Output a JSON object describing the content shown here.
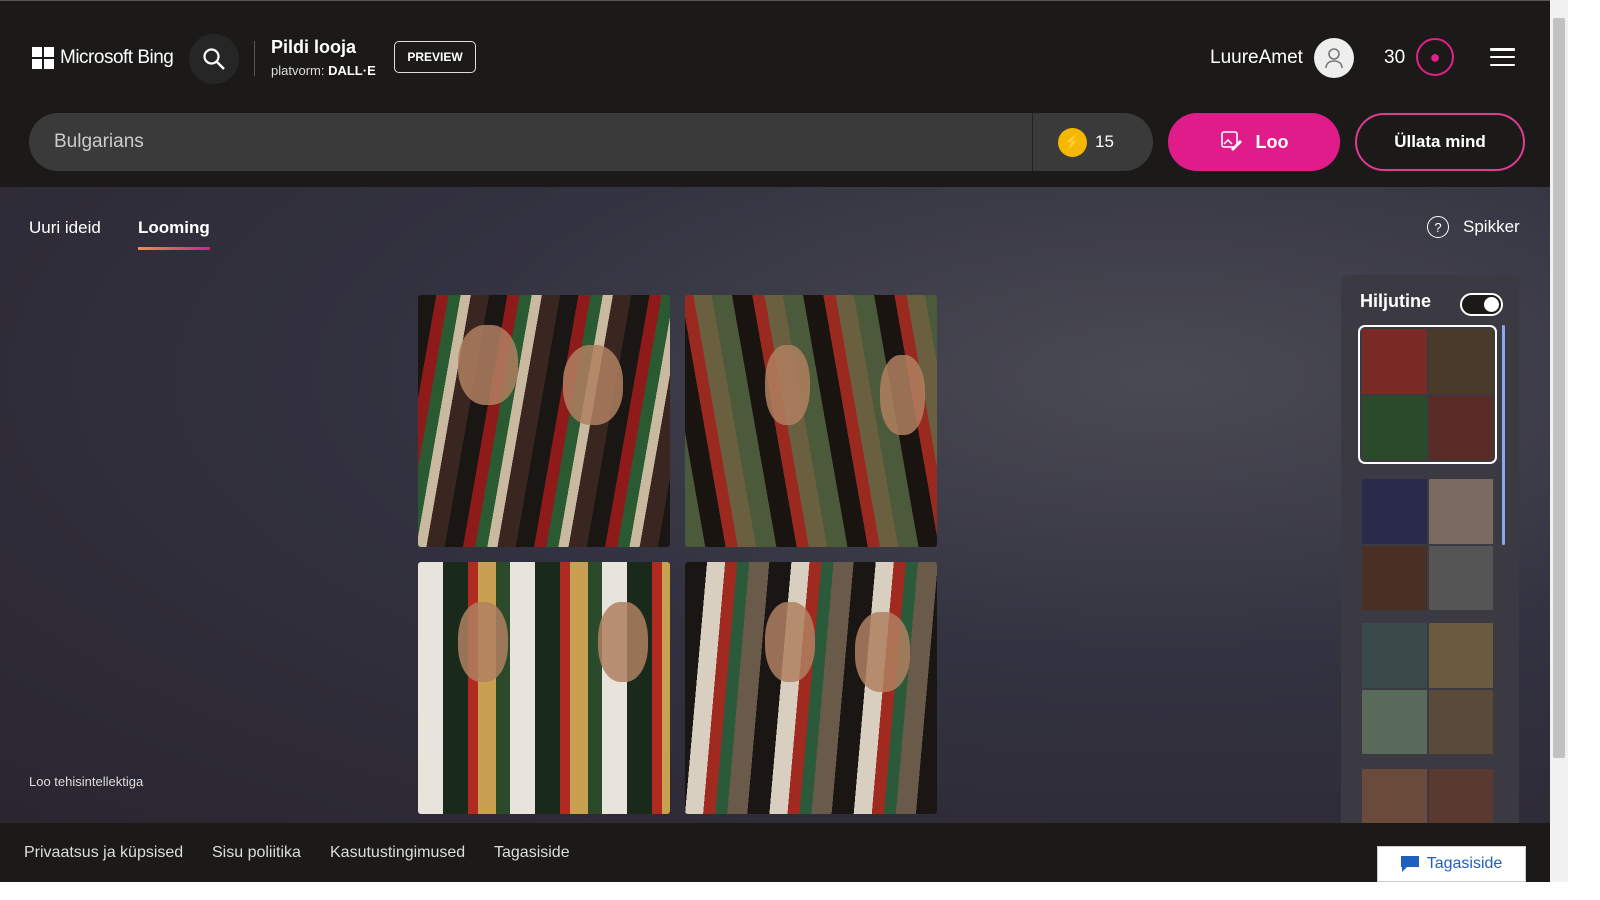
{
  "header": {
    "brand": "Microsoft Bing",
    "title": "Pildi looja",
    "platform_label": "platvorm:",
    "platform_value": "DALL·E",
    "preview": "PREVIEW",
    "username": "LuureAmet",
    "points": "30"
  },
  "search": {
    "value": "Bulgarians",
    "boosts": "15",
    "create": "Loo",
    "surprise": "Üllata mind"
  },
  "tabs": [
    {
      "label": "Uuri ideid"
    },
    {
      "label": "Looming",
      "active": true
    }
  ],
  "help": "Spikker",
  "ai_label": "Loo tehisintellektiga",
  "recent": {
    "title": "Hiljutine",
    "toggle_on": true
  },
  "footer": {
    "links": [
      "Privaatsus ja küpsised",
      "Sisu poliitika",
      "Kasutustingimused",
      "Tagasiside"
    ],
    "feedback": "Tagasiside"
  },
  "colors": {
    "accent": "#e01c8b",
    "header_bg": "#1b1a19"
  }
}
